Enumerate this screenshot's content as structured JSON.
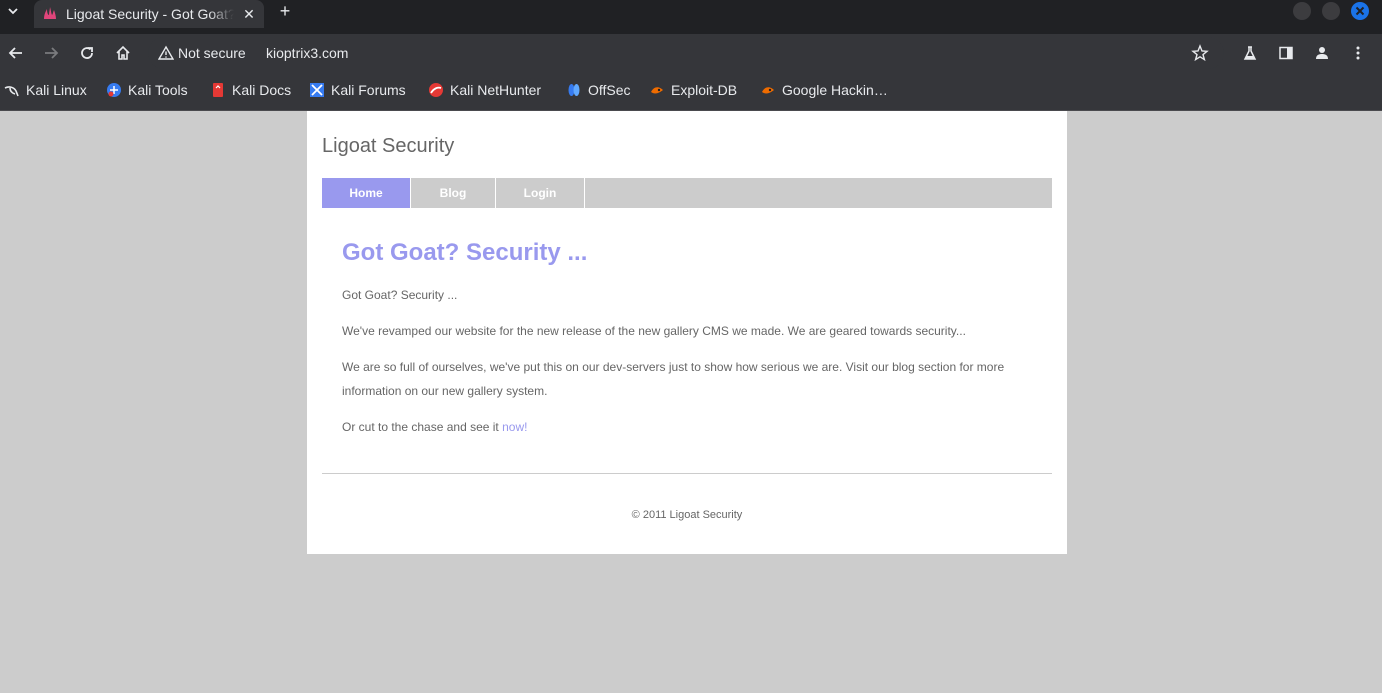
{
  "browser": {
    "tab": {
      "title": "Ligoat Security - Got Goat? Security ..."
    },
    "security_label": "Not secure",
    "url": "kioptrix3.com",
    "bookmarks": [
      {
        "label": "Kali Linux",
        "icon": "kali-dragon-icon"
      },
      {
        "label": "Kali Tools",
        "icon": "kali-tools-icon"
      },
      {
        "label": "Kali Docs",
        "icon": "kali-docs-icon"
      },
      {
        "label": "Kali Forums",
        "icon": "kali-forums-icon"
      },
      {
        "label": "Kali NetHunter",
        "icon": "nethunter-icon"
      },
      {
        "label": "OffSec",
        "icon": "offsec-icon"
      },
      {
        "label": "Exploit-DB",
        "icon": "exploit-db-icon"
      },
      {
        "label": "Google Hackin…",
        "icon": "ghdb-icon"
      }
    ]
  },
  "site": {
    "title": "Ligoat Security",
    "nav": [
      {
        "label": "Home",
        "active": true
      },
      {
        "label": "Blog",
        "active": false
      },
      {
        "label": "Login",
        "active": false
      }
    ],
    "content": {
      "heading": "Got Goat? Security ...",
      "p1": "Got Goat? Security ...",
      "p2": "We've revamped our website for the new release of the new gallery CMS we made. We are geared towards security...",
      "p3": "We are so full of ourselves, we've put this on our dev-servers just to show how serious we are. Visit our blog section for more information on our new gallery system.",
      "p4_text": "Or cut to the chase and see it ",
      "p4_link": "now!"
    },
    "footer": "© 2011 Ligoat Security"
  },
  "colors": {
    "accent": "#9999ee",
    "nav_active": "#9999ee",
    "nav_bg": "#cccccc",
    "page_bg": "#cccccc",
    "text": "#666666"
  }
}
